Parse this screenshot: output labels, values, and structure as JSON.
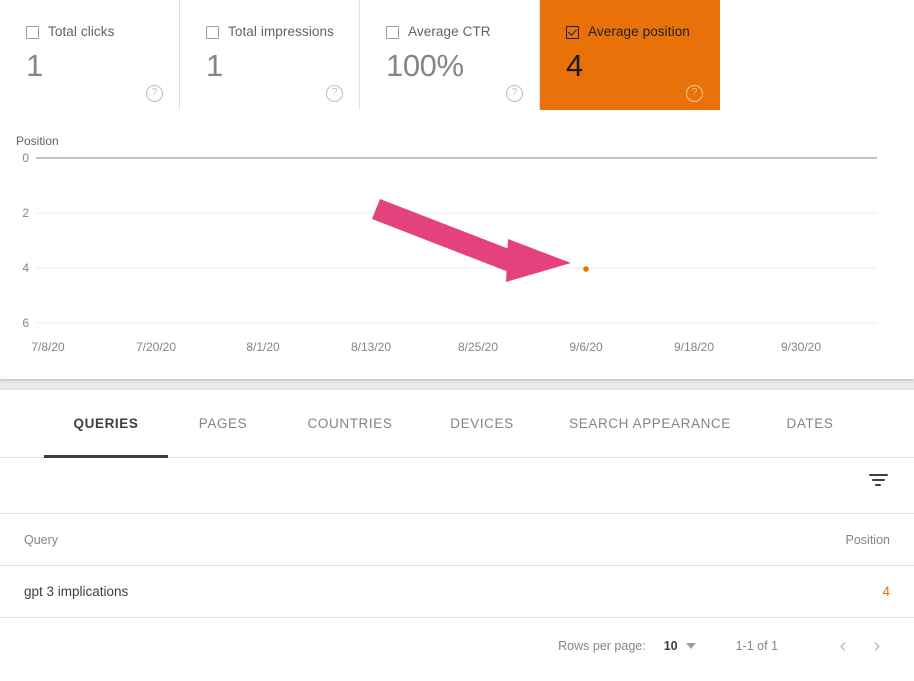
{
  "metrics": [
    {
      "label": "Total clicks",
      "value": "1",
      "checked": false,
      "help": "help-icon"
    },
    {
      "label": "Total impressions",
      "value": "1",
      "checked": false,
      "help": "help-icon"
    },
    {
      "label": "Average CTR",
      "value": "100%",
      "checked": false,
      "help": "help-icon"
    },
    {
      "label": "Average position",
      "value": "4",
      "checked": true,
      "help": "help-icon"
    }
  ],
  "colors": {
    "selected_card": "#e8710a",
    "series_point": "#e8710a",
    "annotation_arrow": "#e4427c",
    "position_value": "#e8710a"
  },
  "chart_data": {
    "type": "scatter",
    "title": "",
    "ylabel": "Position",
    "xlabel": "",
    "ytick_labels": [
      "0",
      "2",
      "4",
      "6"
    ],
    "ytick_values": [
      0,
      2,
      4,
      6
    ],
    "ylim": [
      0,
      6
    ],
    "xtick_labels": [
      "7/8/20",
      "7/20/20",
      "8/1/20",
      "8/13/20",
      "8/25/20",
      "9/6/20",
      "9/18/20",
      "9/30/20"
    ],
    "grid": true,
    "legend": "none",
    "series": [
      {
        "name": "Average position",
        "color": "#e8710a",
        "points": [
          {
            "x": "9/6/20",
            "y": 4
          }
        ]
      }
    ],
    "annotations": [
      {
        "type": "arrow",
        "color": "#e4427c",
        "from": "8/13/20",
        "to": "9/6/20",
        "note": "points to the average position data point"
      }
    ]
  },
  "tabs": [
    {
      "label": "QUERIES",
      "active": true
    },
    {
      "label": "PAGES",
      "active": false
    },
    {
      "label": "COUNTRIES",
      "active": false
    },
    {
      "label": "DEVICES",
      "active": false
    },
    {
      "label": "SEARCH APPEARANCE",
      "active": false
    },
    {
      "label": "DATES",
      "active": false
    }
  ],
  "toolbar": {
    "filter_icon": "filter-icon"
  },
  "table": {
    "columns": {
      "query": "Query",
      "position": "Position"
    },
    "rows": [
      {
        "query": "gpt 3 implications",
        "position": "4"
      }
    ]
  },
  "pagination": {
    "rows_per_page_label": "Rows per page:",
    "rows_per_page_value": "10",
    "range": "1-1 of 1",
    "prev": "‹",
    "next": "›"
  }
}
